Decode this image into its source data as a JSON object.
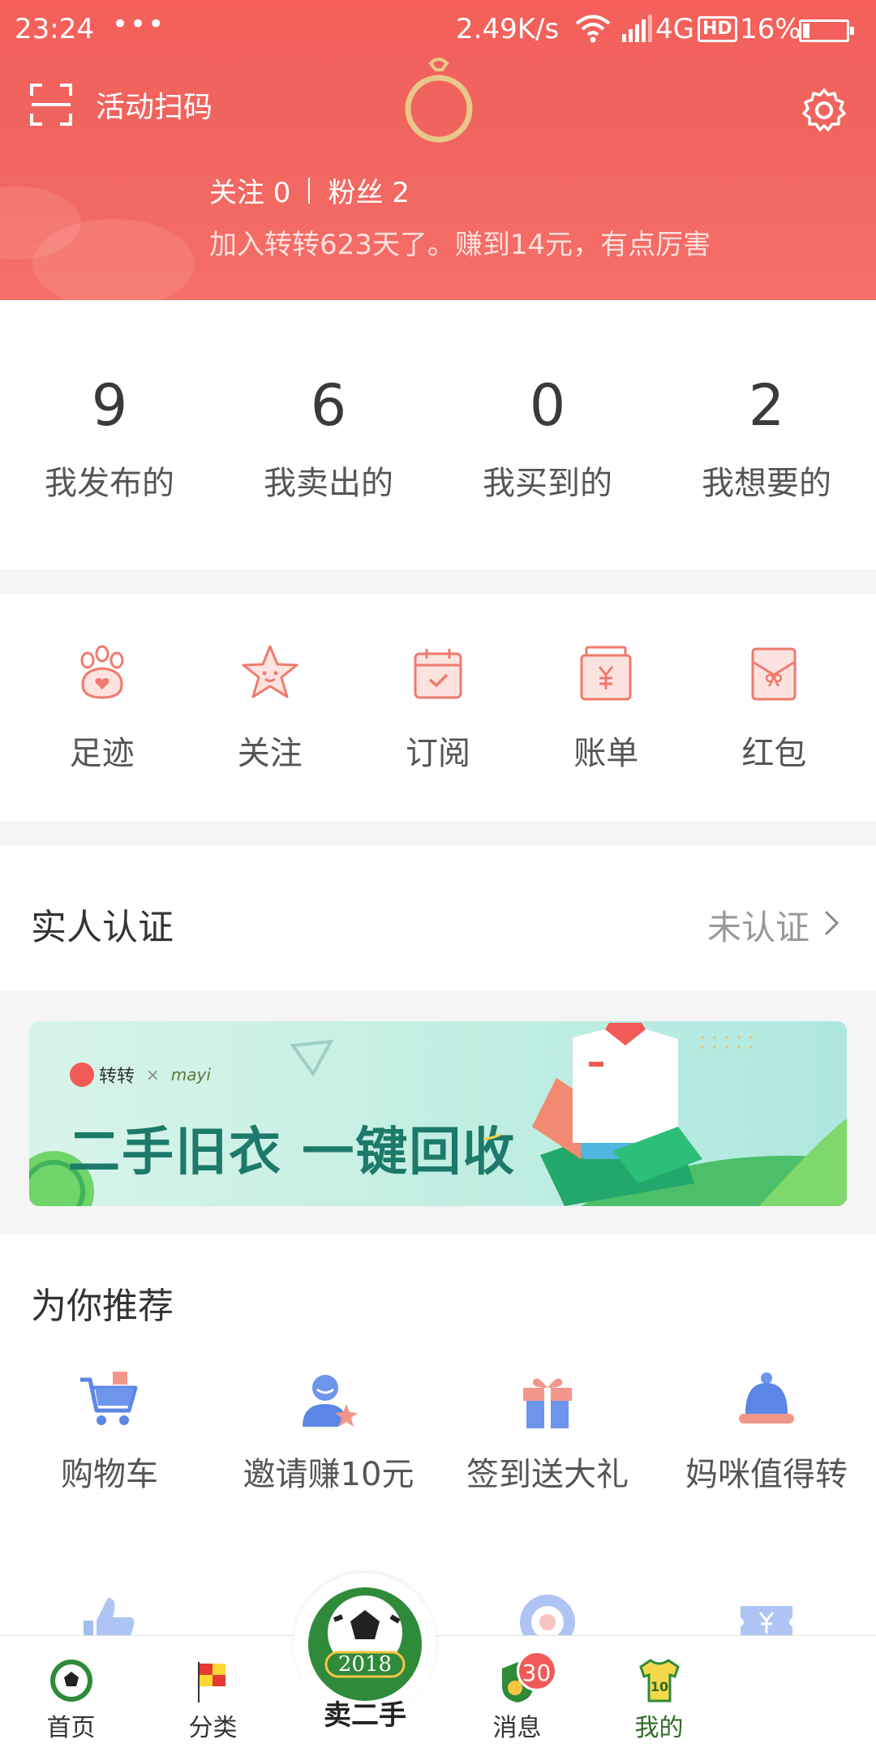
{
  "status_bar": {
    "time": "23:24",
    "dots": "•••",
    "speed": "2.49K/s",
    "network": "4G",
    "hd": "HD",
    "battery": "16%"
  },
  "header": {
    "scan_label": "活动扫码",
    "follow": "关注 0",
    "fans": "粉丝 2",
    "join_text": "加入转转623天了。赚到14元，有点厉害"
  },
  "stats": [
    {
      "num": "9",
      "label": "我发布的"
    },
    {
      "num": "6",
      "label": "我卖出的"
    },
    {
      "num": "0",
      "label": "我买到的"
    },
    {
      "num": "2",
      "label": "我想要的"
    }
  ],
  "tools": [
    {
      "label": "足迹",
      "icon": "paw-icon"
    },
    {
      "label": "关注",
      "icon": "star-icon"
    },
    {
      "label": "订阅",
      "icon": "calendar-icon"
    },
    {
      "label": "账单",
      "icon": "bill-icon"
    },
    {
      "label": "红包",
      "icon": "red-envelope-icon"
    }
  ],
  "verify": {
    "title": "实人认证",
    "status": "未认证"
  },
  "banner": {
    "brand": "转转",
    "x": "×",
    "partner": "mayi",
    "title": "二手旧衣 一键回收"
  },
  "recommend": {
    "title": "为你推荐",
    "items": [
      {
        "label": "购物车",
        "icon": "cart-icon"
      },
      {
        "label": "邀请赚10元",
        "icon": "invite-icon"
      },
      {
        "label": "签到送大礼",
        "icon": "gift-icon"
      },
      {
        "label": "妈咪值得转",
        "icon": "baby-hat-icon"
      }
    ]
  },
  "bottom_nav": {
    "home": "首页",
    "category": "分类",
    "sell": "卖二手",
    "sell_badge_year": "2018",
    "messages": "消息",
    "messages_badge": "30",
    "mine": "我的",
    "jersey_number": "10"
  },
  "colors": {
    "brand_red": "#f25a57",
    "active_nav": "#2f6b25",
    "icon_blue": "#5b86e5"
  }
}
